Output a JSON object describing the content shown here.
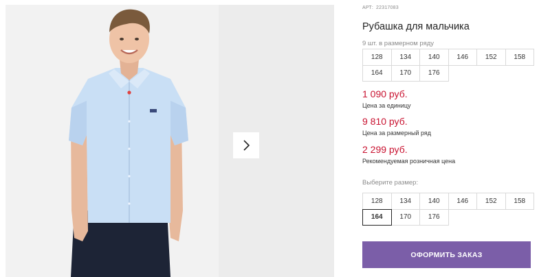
{
  "product": {
    "sku_label": "АРТ:",
    "sku_value": "22317083",
    "title": "Рубашка для мальчика",
    "row_note": "9 шт. в размерном ряду"
  },
  "size_row": [
    "128",
    "134",
    "140",
    "146",
    "152",
    "158",
    "164",
    "170",
    "176"
  ],
  "prices": {
    "unit_price": "1 090 руб.",
    "unit_label": "Цена за единицу",
    "row_price": "9 810 руб.",
    "row_label": "Цена за размерный ряд",
    "retail_price": "2 299 руб.",
    "retail_label": "Рекомендуемая розничная цена"
  },
  "size_select": {
    "label": "Выберите размер:",
    "options": [
      "128",
      "134",
      "140",
      "146",
      "152",
      "158",
      "164",
      "170",
      "176"
    ],
    "selected": "164"
  },
  "order_button": "ОФОРМИТЬ ЗАКАЗ",
  "icons": {
    "next": "chevron-right-icon"
  },
  "colors": {
    "accent": "#7b5ea8",
    "price": "#c8102e"
  }
}
